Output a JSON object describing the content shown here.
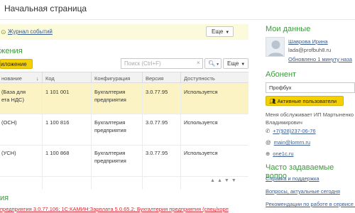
{
  "page": {
    "title": "Начальная страница"
  },
  "toolbar": {
    "events_link": "Журнал событий",
    "more_label": "Еще"
  },
  "apps_section": {
    "heading": "жения",
    "add_button": "иложение",
    "search_placeholder": "Поиск (Ctrl+F)",
    "search_clear": "×",
    "search_button_icon": "magnifier-icon",
    "more_label": "Еще",
    "columns": [
      "нование",
      "Код",
      "Конфигурация",
      "Версия",
      "Доступность"
    ],
    "rows": [
      {
        "name_line1": "(База для",
        "name_line2": "ета НДС)",
        "code": "1 101 001",
        "config_line1": "Бухгалтерия",
        "config_line2": "предприятия",
        "version": "3.0.77.95",
        "availability": "Используется",
        "selected": true
      },
      {
        "name_line1": "(ОСН)",
        "name_line2": "",
        "code": "1 100 816",
        "config_line1": "Бухгалтерия",
        "config_line2": "предприятия",
        "version": "3.0.77.95",
        "availability": "Используется",
        "selected": false
      },
      {
        "name_line1": "(УСН)",
        "name_line2": "",
        "code": "1 100 868",
        "config_line1": "Бухгалтерия",
        "config_line2": "предприятия",
        "version": "3.0.77.95",
        "availability": "Используется",
        "selected": false
      }
    ]
  },
  "updates_section": {
    "heading": "ия",
    "links_text": "предприятия 3.0.77.106; 1С:КАМИН:Зарплата 5.0.65.2; Бухгалтерия предприятия (спец/корп"
  },
  "my_data": {
    "heading": "Мои данные",
    "name": "Шаврова Ирина",
    "email": "lada@profbuh8.ru",
    "updated": "Обновлено 1 минуту наза"
  },
  "subscriber": {
    "heading": "Абонент",
    "value": "Профбух",
    "active_users_button": "Активные пользователи",
    "served_by": "Меня обслуживает ИП Мартыненко Владимирович",
    "phone": "+7(928)237-06-76",
    "email": "main@lomrn.ru",
    "site": "one1c.ru"
  },
  "faq": {
    "heading": "Часто задаваемые вопро",
    "links": [
      "Справка и поддержка",
      "Вопросы, актуальные сегодня",
      "Рекомендации по работе в сервисе ф"
    ]
  }
}
